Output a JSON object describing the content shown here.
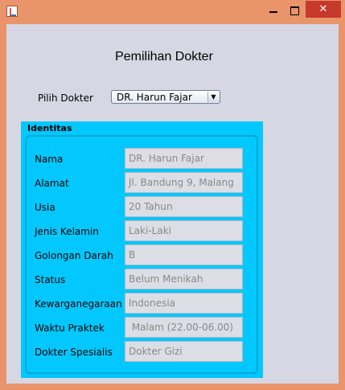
{
  "window": {
    "close_glyph": "✕"
  },
  "header": {
    "title": "Pemilihan Dokter"
  },
  "picker": {
    "label": "Pilih Dokter",
    "selected": "DR. Harun Fajar",
    "arrow": "▼"
  },
  "identity": {
    "title": "Identitas",
    "rows": [
      {
        "label": "Nama",
        "value": "DR. Harun Fajar"
      },
      {
        "label": "Alamat",
        "value": "Jl. Bandung 9, Malang"
      },
      {
        "label": "Usia",
        "value": "20 Tahun"
      },
      {
        "label": "Jenis Kelamin",
        "value": "Laki-Laki"
      },
      {
        "label": "Golongan Darah",
        "value": "B"
      },
      {
        "label": "Status",
        "value": "Belum Menikah"
      },
      {
        "label": "Kewarganegaraan",
        "value": "Indonesia"
      },
      {
        "label": "Waktu Praktek",
        "value": " Malam (22.00-06.00)"
      },
      {
        "label": "Dokter Spesialis",
        "value": "Dokter Gizi"
      }
    ]
  },
  "colors": {
    "titlebar": "#e9946b",
    "panel": "#03c8ff",
    "content": "#d6d7e2",
    "close": "#c7392c"
  }
}
